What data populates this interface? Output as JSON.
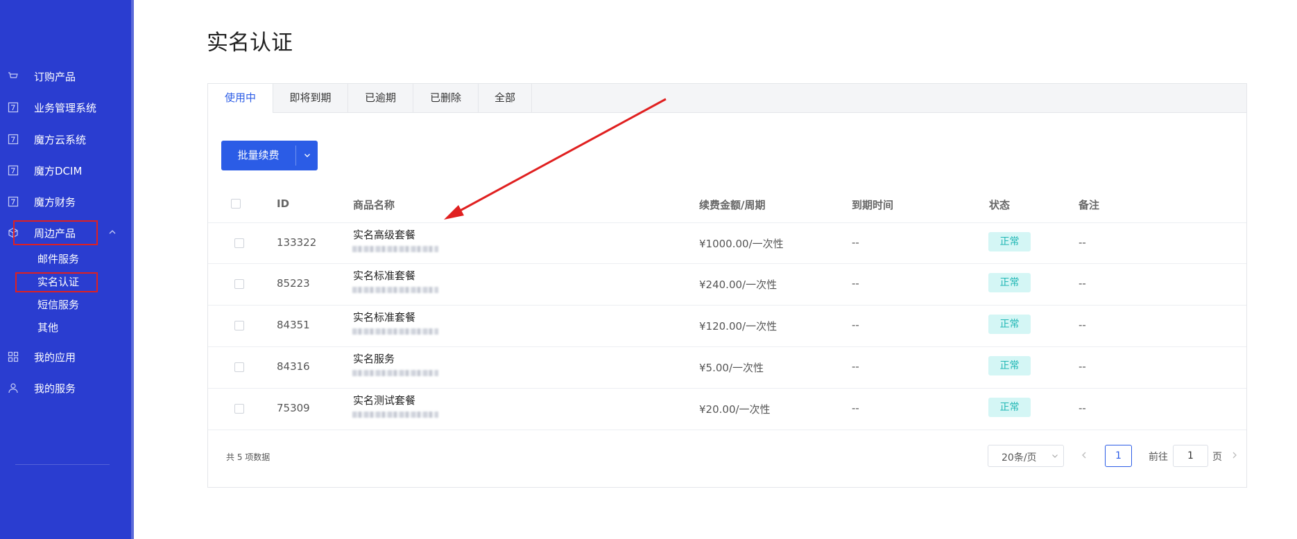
{
  "sidebar": {
    "items": [
      {
        "label": "订购产品",
        "icon": "cart-icon"
      },
      {
        "label": "业务管理系统",
        "icon": "app-window-icon"
      },
      {
        "label": "魔方云系统",
        "icon": "app-window-icon"
      },
      {
        "label": "魔方DCIM",
        "icon": "app-window-icon"
      },
      {
        "label": "魔方财务",
        "icon": "app-window-icon"
      },
      {
        "label": "周边产品",
        "icon": "cube-icon"
      },
      {
        "label": "我的应用",
        "icon": "grid-icon"
      },
      {
        "label": "我的服务",
        "icon": "user-icon"
      }
    ],
    "sub_items": [
      {
        "label": "邮件服务"
      },
      {
        "label": "实名认证"
      },
      {
        "label": "短信服务"
      },
      {
        "label": "其他"
      }
    ]
  },
  "page": {
    "title": "实名认证"
  },
  "tabs": [
    {
      "label": "使用中",
      "active": true
    },
    {
      "label": "即将到期"
    },
    {
      "label": "已逾期"
    },
    {
      "label": "已删除"
    },
    {
      "label": "全部"
    }
  ],
  "toolbar": {
    "batch_renew_label": "批量续费"
  },
  "table": {
    "headers": {
      "id": "ID",
      "name": "商品名称",
      "amount": "续费金额/周期",
      "expire": "到期时间",
      "status": "状态",
      "remark": "备注"
    },
    "rows": [
      {
        "id": "133322",
        "name": "实名高级套餐",
        "amount": "¥1000.00/一次性",
        "expire": "--",
        "status": "正常",
        "remark": "--"
      },
      {
        "id": "85223",
        "name": "实名标准套餐",
        "amount": "¥240.00/一次性",
        "expire": "--",
        "status": "正常",
        "remark": "--"
      },
      {
        "id": "84351",
        "name": "实名标准套餐",
        "amount": "¥120.00/一次性",
        "expire": "--",
        "status": "正常",
        "remark": "--"
      },
      {
        "id": "84316",
        "name": "实名服务",
        "amount": "¥5.00/一次性",
        "expire": "--",
        "status": "正常",
        "remark": "--"
      },
      {
        "id": "75309",
        "name": "实名测试套餐",
        "amount": "¥20.00/一次性",
        "expire": "--",
        "status": "正常",
        "remark": "--"
      }
    ]
  },
  "pagination": {
    "total_text": "共 5 项数据",
    "page_size": "20条/页",
    "current_page": "1",
    "goto_prefix": "前往",
    "goto_value": "1",
    "goto_suffix": "页"
  },
  "colors": {
    "sidebar_bg": "#2a3dd0",
    "accent": "#2b5ce6",
    "status_bg": "#d4f6f5",
    "status_text": "#1fb6b4",
    "highlight_red": "#e02020"
  }
}
